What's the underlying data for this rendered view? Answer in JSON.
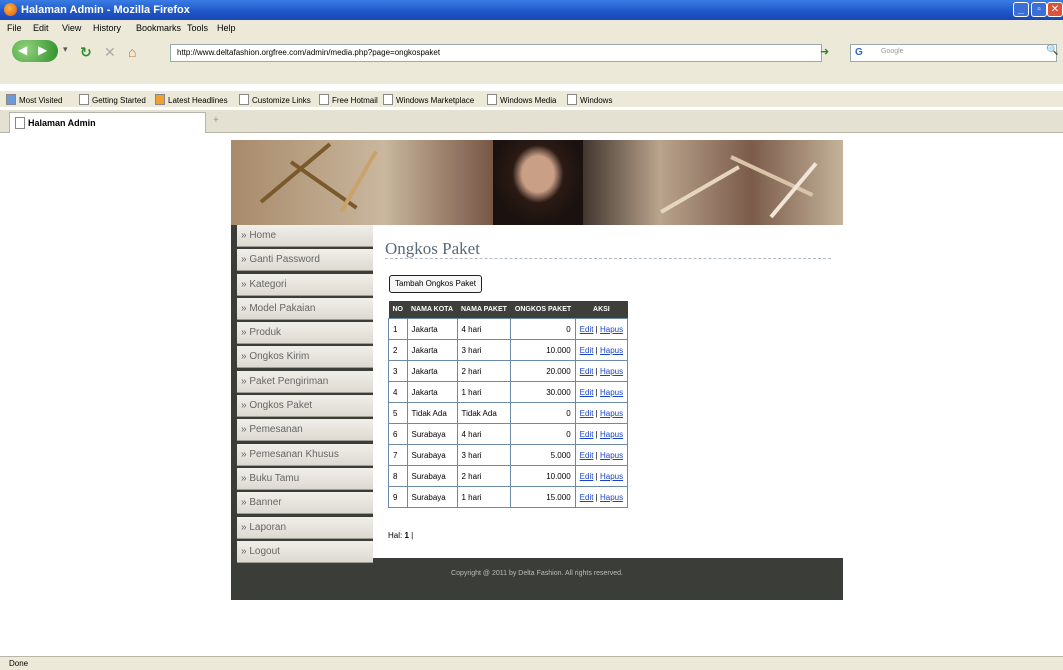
{
  "window": {
    "title": "Halaman Admin - Mozilla Firefox",
    "min": "_",
    "max": "▫",
    "close": "✕"
  },
  "menu": [
    "File",
    "Edit",
    "View",
    "History",
    "Bookmarks",
    "Tools",
    "Help"
  ],
  "nav": {
    "url": "http://www.deltafashion.orgfree.com/admin/media.php?page=ongkospaket",
    "search_placeholder": "Google",
    "search_logo": "G"
  },
  "bookmarks": [
    "Most Visited",
    "Getting Started",
    "Latest Headlines",
    "Customize Links",
    "Free Hotmail",
    "Windows Marketplace",
    "Windows Media",
    "Windows"
  ],
  "tab": {
    "label": "Halaman Admin",
    "new_tab": "+"
  },
  "sidebar": {
    "items": [
      "» Home",
      "» Ganti Password",
      "» Kategori",
      "» Model Pakaian",
      "» Produk",
      "» Ongkos Kirim",
      "» Paket Pengiriman",
      "» Ongkos Paket",
      "» Pemesanan",
      "» Pemesanan Khusus",
      "» Buku Tamu",
      "» Banner",
      "» Laporan",
      "» Logout"
    ]
  },
  "main": {
    "heading": "Ongkos Paket",
    "add_button": "Tambah Ongkos Paket",
    "table": {
      "headers": [
        "NO",
        "NAMA KOTA",
        "NAMA PAKET",
        "ONGKOS PAKET",
        "AKSI"
      ],
      "rows": [
        [
          "1",
          "Jakarta",
          "4 hari",
          "0"
        ],
        [
          "2",
          "Jakarta",
          "3 hari",
          "10.000"
        ],
        [
          "3",
          "Jakarta",
          "2 hari",
          "20.000"
        ],
        [
          "4",
          "Jakarta",
          "1 hari",
          "30.000"
        ],
        [
          "5",
          "Tidak Ada",
          "Tidak Ada",
          "0"
        ],
        [
          "6",
          "Surabaya",
          "4 hari",
          "0"
        ],
        [
          "7",
          "Surabaya",
          "3 hari",
          "5.000"
        ],
        [
          "8",
          "Surabaya",
          "2 hari",
          "10.000"
        ],
        [
          "9",
          "Surabaya",
          "1 hari",
          "15.000"
        ]
      ],
      "edit_label": "Edit",
      "separator": " | ",
      "delete_label": "Hapus"
    },
    "pagination_label": "Hal:",
    "pagination_current": "1",
    "pagination_sep": "|"
  },
  "footer": "Copyright @ 2011 by Delta Fashion. All rights reserved.",
  "status": "Done",
  "colors": {
    "titlebar": "#1f55c8",
    "site_bg": "#3a3d38",
    "link": "#1a44c8",
    "table_header": "#3e3f3b"
  }
}
